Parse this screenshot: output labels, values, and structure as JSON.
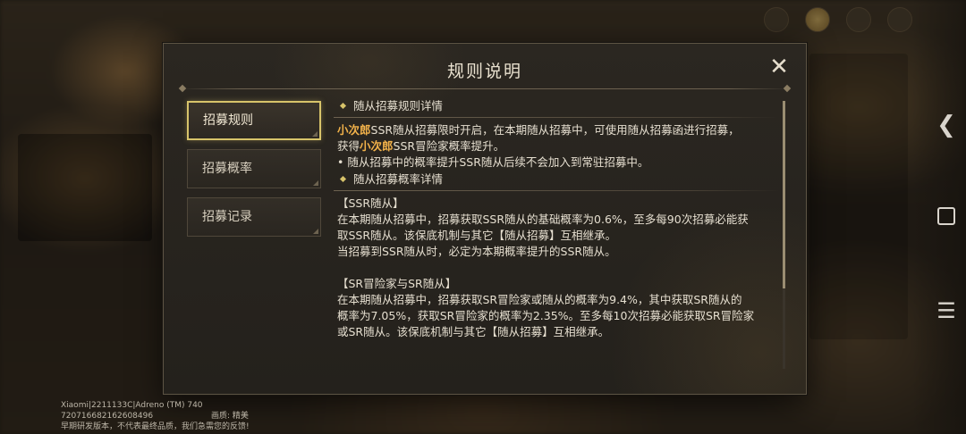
{
  "modal": {
    "title": "规则说明",
    "close_icon": "close-icon"
  },
  "tabs": [
    {
      "label": "招募规则",
      "active": true
    },
    {
      "label": "招募概率",
      "active": false
    },
    {
      "label": "招募记录",
      "active": false
    }
  ],
  "content": {
    "section1_title": "随从招募规则详情",
    "para1_line1_hl": "小次郎",
    "para1_line1_text": "SSR随从招募限时开启，在本期随从招募中，可使用随从招募函进行招募，",
    "para1_line2_pre": "获得",
    "para1_line2_hl": "小次郎",
    "para1_line2_post": "SSR冒险家概率提升。",
    "para2": "•  随从招募中的概率提升SSR随从后续不会加入到常驻招募中。",
    "section2_title": "随从招募概率详情",
    "ssr_head": "【SSR随从】",
    "ssr_line1": "在本期随从招募中，招募获取SSR随从的基础概率为0.6%，至多每90次招募必能获",
    "ssr_line2": "取SSR随从。该保底机制与其它【随从招募】互相继承。",
    "ssr_line3": "当招募到SSR随从时，必定为本期概率提升的SSR随从。",
    "sr_head": "【SR冒险家与SR随从】",
    "sr_line1": "在本期随从招募中，招募获取SR冒险家或随从的概率为9.4%，其中获取SR随从的",
    "sr_line2": "概率为7.05%，获取SR冒险家的概率为2.35%。至多每10次招募必能获取SR冒险家",
    "sr_line3": "或SR随从。该保底机制与其它【随从招募】互相继承。"
  },
  "device_info": {
    "line1": "Xiaomi|2211133C|Adreno (TM) 740",
    "line2": "720716682162608496",
    "quality": "画质: 精美",
    "line3": "早期研发版本，不代表最终品质，我们急需您的反馈!"
  },
  "colors": {
    "highlight": "#f2b24a",
    "tab_active_border": "#d7c36a"
  }
}
